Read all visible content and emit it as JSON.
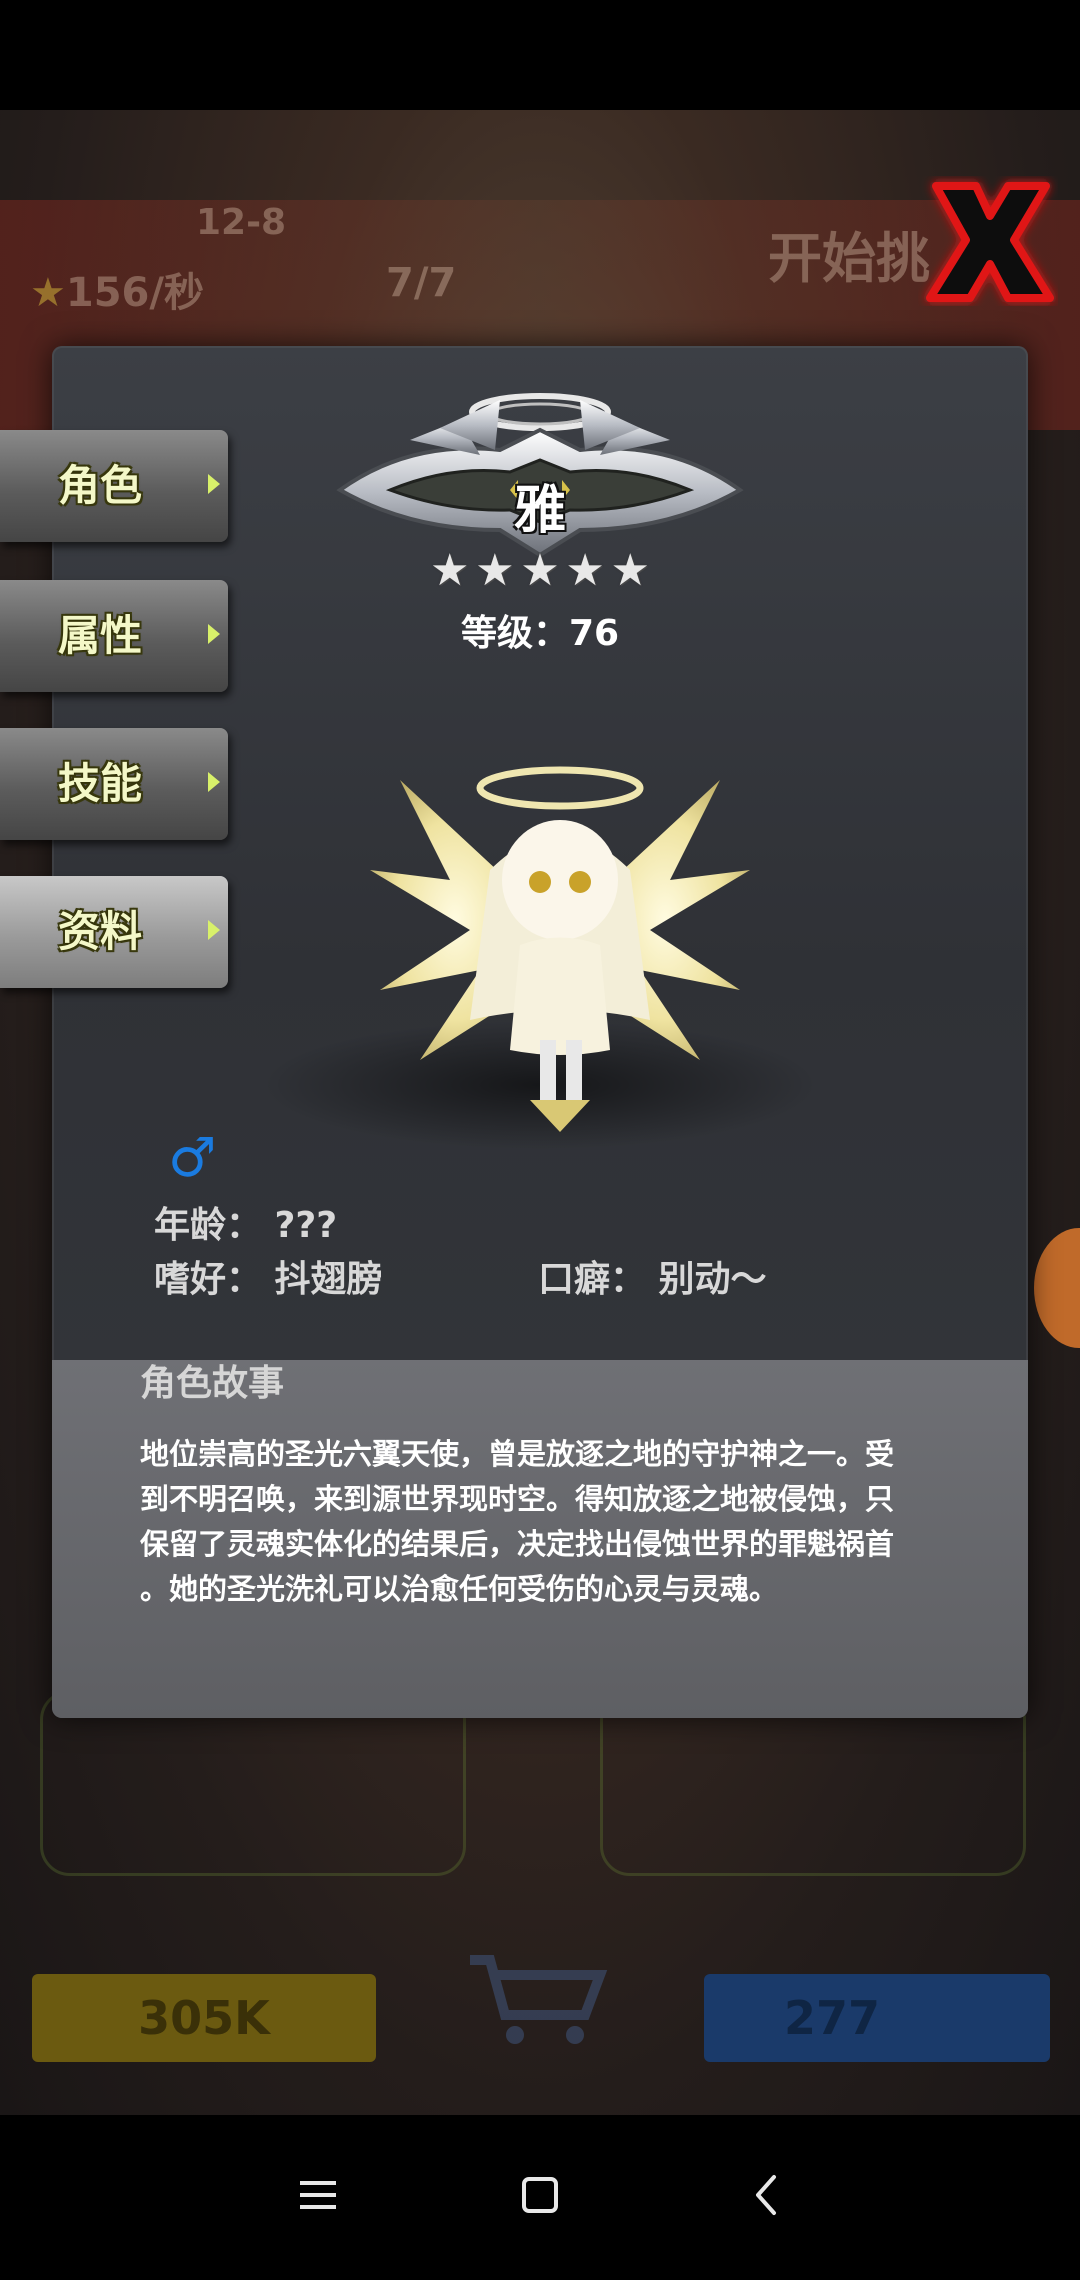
{
  "background": {
    "stage": "12-8",
    "rate": "156/秒",
    "count": "7/7",
    "start_button": "开始挑",
    "gold": "305K",
    "gems": "277"
  },
  "tabs": [
    {
      "label": "角色",
      "active": false
    },
    {
      "label": "属性",
      "active": false
    },
    {
      "label": "技能",
      "active": false
    },
    {
      "label": "资料",
      "active": true
    }
  ],
  "character": {
    "name": "雅",
    "stars": 5,
    "level_label": "等级：76"
  },
  "profile": {
    "gender_symbol": "♂",
    "age": "年龄： ???",
    "hobby": "嗜好： 抖翅膀",
    "catchphrase": "口癖： 别动～"
  },
  "story": {
    "title": "角色故事",
    "lines": [
      "地位崇高的圣光六翼天使，曾是放逐之地的守护神之一。受",
      "到不明召唤，来到源世界现时空。得知放逐之地被侵蚀，只",
      "保留了灵魂实体化的结果后，决定找出侵蚀世界的罪魁祸首",
      "。她的圣光洗礼可以治愈任何受伤的心灵与灵魂。"
    ]
  },
  "colors": {
    "close_red": "#e01818",
    "gender_blue": "#1a7be0",
    "tab_text": "#f4f8c8"
  }
}
